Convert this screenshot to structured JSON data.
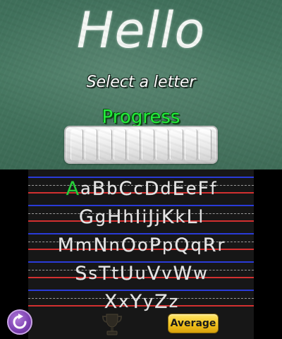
{
  "top": {
    "title": "Hello",
    "prompt": "Select a letter",
    "progress_label": "Progress",
    "progress_value": 0,
    "progress_segments": 10
  },
  "board": {
    "rows": [
      [
        {
          "char": "A",
          "selected": true
        },
        {
          "char": "a"
        },
        {
          "char": "B"
        },
        {
          "char": "b"
        },
        {
          "char": "C"
        },
        {
          "char": "c"
        },
        {
          "char": "D"
        },
        {
          "char": "d"
        },
        {
          "char": "E"
        },
        {
          "char": "e"
        },
        {
          "char": "F"
        },
        {
          "char": "f"
        }
      ],
      [
        {
          "char": "G"
        },
        {
          "char": "g"
        },
        {
          "char": "H"
        },
        {
          "char": "h"
        },
        {
          "char": "I"
        },
        {
          "char": "i"
        },
        {
          "char": "J"
        },
        {
          "char": "j"
        },
        {
          "char": "K"
        },
        {
          "char": "k"
        },
        {
          "char": "L"
        },
        {
          "char": "l"
        }
      ],
      [
        {
          "char": "M"
        },
        {
          "char": "m"
        },
        {
          "char": "N"
        },
        {
          "char": "n"
        },
        {
          "char": "O"
        },
        {
          "char": "o"
        },
        {
          "char": "P"
        },
        {
          "char": "p"
        },
        {
          "char": "Q"
        },
        {
          "char": "q"
        },
        {
          "char": "R"
        },
        {
          "char": "r"
        }
      ],
      [
        {
          "char": "S"
        },
        {
          "char": "s"
        },
        {
          "char": "T"
        },
        {
          "char": "t"
        },
        {
          "char": "U"
        },
        {
          "char": "u"
        },
        {
          "char": "V"
        },
        {
          "char": "v"
        },
        {
          "char": "W"
        },
        {
          "char": "w"
        }
      ],
      [
        {
          "char": "X"
        },
        {
          "char": "x"
        },
        {
          "char": "Y"
        },
        {
          "char": "y"
        },
        {
          "char": "Z"
        },
        {
          "char": "z"
        }
      ]
    ]
  },
  "controls": {
    "reset_icon": "refresh-icon",
    "trophy_icon": "trophy-icon",
    "average_label": "Average"
  },
  "colors": {
    "chalkboard": "#467861",
    "progress_text": "#22ee3a",
    "selected_letter": "#29d13c",
    "guide_blue": "#2a3bd8",
    "guide_red": "#d33030",
    "average_button": "#f2c21a",
    "reset_button": "#7b3fb0"
  }
}
